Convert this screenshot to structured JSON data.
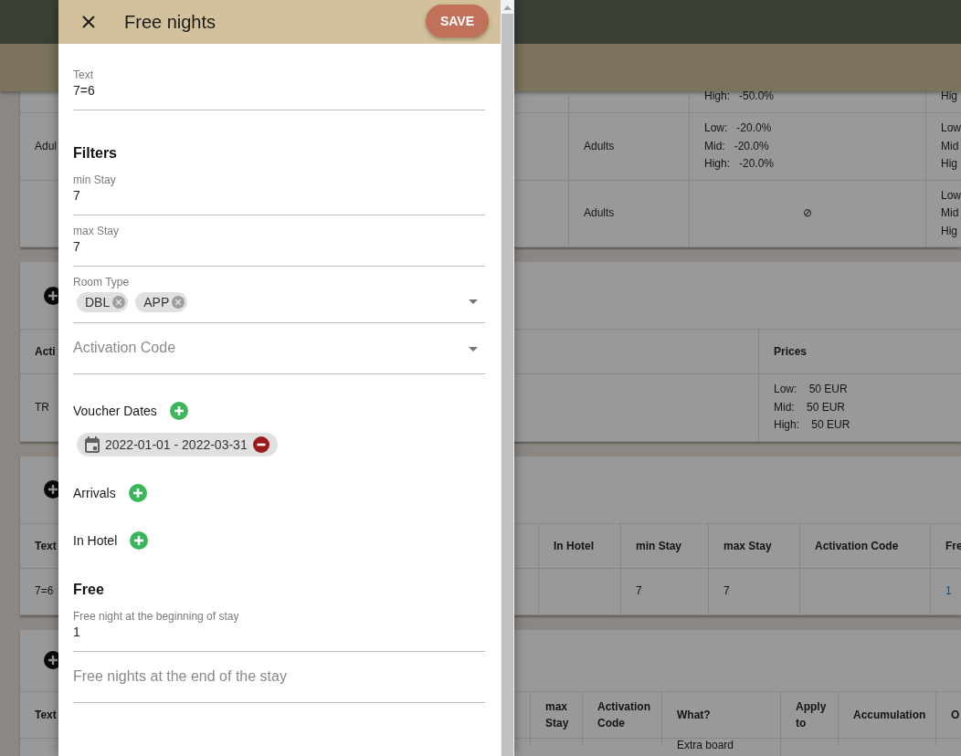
{
  "background": {
    "cards": [
      {
        "add_button": false,
        "rows": [
          {
            "header": false,
            "cells": [
              {},
              {},
              {
                "lines": [
                  "High:   -50.0%"
                ]
              },
              {
                "lines": [
                  "Hig"
                ]
              }
            ]
          },
          {
            "header": false,
            "cells": [
              {
                "lines": [
                  "Adul"
                ]
              },
              {
                "lines": [
                  "Adults"
                ]
              },
              {
                "lines": [
                  "Low:   -20.0%",
                  "Mid:   -20.0%",
                  "High:   -20.0%"
                ]
              },
              {
                "lines": [
                  "Low",
                  "Mid",
                  "Hig"
                ]
              }
            ]
          },
          {
            "header": false,
            "cells": [
              {},
              {
                "lines": [
                  "Adults"
                ]
              },
              {
                "kind": "symbol",
                "lines": [
                  "⊘"
                ]
              },
              {
                "lines": [
                  "Low",
                  "Mid",
                  "Hig"
                ]
              }
            ]
          }
        ]
      },
      {
        "add_button": true,
        "rows": [
          {
            "header": true,
            "cells": [
              {
                "lines": [
                  "Acti"
                ]
              },
              {
                "lines": [
                  "Prices"
                ]
              }
            ]
          },
          {
            "header": false,
            "cells": [
              {
                "lines": [
                  "TR"
                ]
              },
              {
                "lines": [
                  "Low:    50 EUR",
                  "Mid:    50 EUR",
                  "High:    50 EUR"
                ]
              }
            ]
          }
        ]
      },
      {
        "add_button": true,
        "rows": [
          {
            "header": true,
            "cells": [
              {
                "lines": [
                  "Text"
                ]
              },
              {
                "lines": [
                  "In Hotel"
                ]
              },
              {
                "lines": [
                  "min Stay"
                ]
              },
              {
                "lines": [
                  "max Stay"
                ]
              },
              {
                "lines": [
                  "Activation Code"
                ]
              },
              {
                "lines": [
                  "Fre"
                ]
              }
            ]
          },
          {
            "header": false,
            "cells": [
              {
                "lines": [
                  "7=6"
                ]
              },
              {},
              {
                "lines": [
                  "7"
                ]
              },
              {
                "lines": [
                  "7"
                ]
              },
              {},
              {
                "lines": [
                  "1"
                ],
                "link": true
              }
            ]
          }
        ]
      },
      {
        "add_button": true,
        "rows": [
          {
            "header": true,
            "cells": [
              {
                "lines": [
                  "Text"
                ]
              },
              {
                "lines": [
                  "max Stay"
                ]
              },
              {
                "lines": [
                  "Activation Code"
                ]
              },
              {
                "lines": [
                  "What?"
                ]
              },
              {
                "lines": [
                  "Apply to"
                ]
              },
              {
                "lines": [
                  "Accumulation"
                ]
              },
              {
                "lines": [
                  "O"
                ]
              }
            ]
          },
          {
            "header": false,
            "cells": [
              {},
              {},
              {},
              {
                "lines": [
                  "Extra board"
                ]
              },
              {},
              {},
              {}
            ]
          }
        ]
      }
    ]
  },
  "dialog": {
    "title": "Free nights",
    "save_label": "SAVE",
    "fields": [
      {
        "kind": "text",
        "label": "Text",
        "value": "7=6"
      },
      {
        "kind": "heading",
        "text": "Filters"
      },
      {
        "kind": "text",
        "label": "min Stay",
        "value": "7"
      },
      {
        "kind": "text",
        "label": "max Stay",
        "value": "7"
      },
      {
        "kind": "chips",
        "label": "Room Type",
        "chips": [
          "DBL",
          "APP"
        ]
      },
      {
        "kind": "select",
        "placeholder": "Activation Code"
      },
      {
        "kind": "add-list",
        "label": "Voucher Dates",
        "items": [
          "2022-01-01 - 2022-03-31"
        ]
      },
      {
        "kind": "add-list",
        "label": "Arrivals"
      },
      {
        "kind": "add-list",
        "label": "In Hotel"
      },
      {
        "kind": "heading",
        "text": "Free"
      },
      {
        "kind": "text",
        "label": "Free night at the beginning of stay",
        "value": "1"
      },
      {
        "kind": "text",
        "placeholder": "Free nights at the end of the stay"
      }
    ]
  }
}
